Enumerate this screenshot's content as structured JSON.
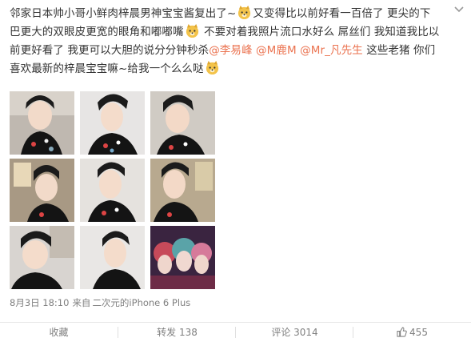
{
  "post": {
    "text_line1_a": "邻家日本帅小哥小鲜肉梓晨男神宝宝酱复出了~",
    "text_line1_b": "又变得比以前好看一百倍了 更尖的下",
    "text_line2_a": "巴更大的双眼皮更宽的眼角和嘟嘟嘴",
    "text_line2_b": "不要对着我照片流口水好么 屌丝们 我知道我比以",
    "text_line3_a": "前更好看了 我更可以大胆的说分分钟秒杀",
    "mention_1": "@李易峰",
    "mention_2": "@M鹿M",
    "mention_3": "@Mr_凡先生",
    "text_line3_b": "这些老猪 你们",
    "text_line4": "喜欢最新的梓晨宝宝嘛~给我一个么么哒",
    "emoji_name": "doge-emoji",
    "menu_icon": "chevron-down-icon"
  },
  "meta": {
    "date": "8月3日 18:10",
    "from_label": "来自",
    "source": "二次元的iPhone 6 Plus"
  },
  "actions": {
    "favorite": "收藏",
    "repost": "转发 138",
    "comment": "评论 3014",
    "like_count": "455"
  },
  "photos": {
    "count": 9,
    "colors": {
      "hair": "#1b1b1b",
      "skin": "#f4dccb",
      "shirt": "#141414"
    }
  }
}
